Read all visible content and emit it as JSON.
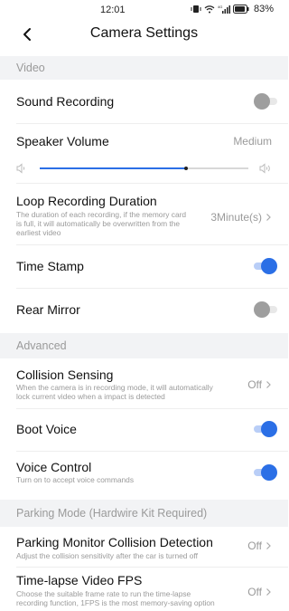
{
  "status": {
    "time": "12:01",
    "signal": "4G",
    "battery": "83%"
  },
  "header": {
    "title": "Camera Settings"
  },
  "sections": {
    "video": "Video",
    "advanced": "Advanced",
    "parking": "Parking Mode (Hardwire Kit Required)"
  },
  "video": {
    "sound_recording": {
      "title": "Sound Recording",
      "enabled": false
    },
    "speaker_volume": {
      "title": "Speaker Volume",
      "value": "Medium",
      "level": 0.7
    },
    "loop_recording": {
      "title": "Loop Recording Duration",
      "desc_1": "The duration of each recording, if the memory card",
      "desc_2": "is full, it will automatically be overwritten from the",
      "desc_3": "earliest video",
      "value": "3Minute(s)"
    },
    "time_stamp": {
      "title": "Time Stamp",
      "enabled": true
    },
    "rear_mirror": {
      "title": "Rear Mirror",
      "enabled": false
    }
  },
  "advanced": {
    "collision_sensing": {
      "title": "Collision Sensing",
      "desc_1": "When the camera is in recording mode, it will automatically",
      "desc_2": "lock current video when a impact is detected",
      "value": "Off"
    },
    "boot_voice": {
      "title": "Boot Voice",
      "enabled": true
    },
    "voice_control": {
      "title": "Voice Control",
      "desc": "Turn on to accept voice commands",
      "enabled": true
    }
  },
  "parking": {
    "monitor": {
      "title": "Parking Monitor Collision Detection",
      "desc": "Adjust the collision sensitivity after the car is turned off",
      "value": "Off"
    },
    "timelapse": {
      "title": "Time-lapse Video FPS",
      "desc_1": "Choose the suitable frame rate to run the time-lapse",
      "desc_2": "recording function, 1FPS is the most memory-saving option",
      "value": "Off"
    }
  },
  "colors": {
    "accent": "#2b6fe6",
    "section_bg": "#f2f3f5",
    "muted_text": "#9a9a9a"
  },
  "icons": [
    "back-arrow-icon",
    "vibrate-icon",
    "wifi-icon",
    "signal-icon",
    "battery-icon",
    "volume-low-icon",
    "volume-high-icon",
    "chevron-right-icon"
  ]
}
